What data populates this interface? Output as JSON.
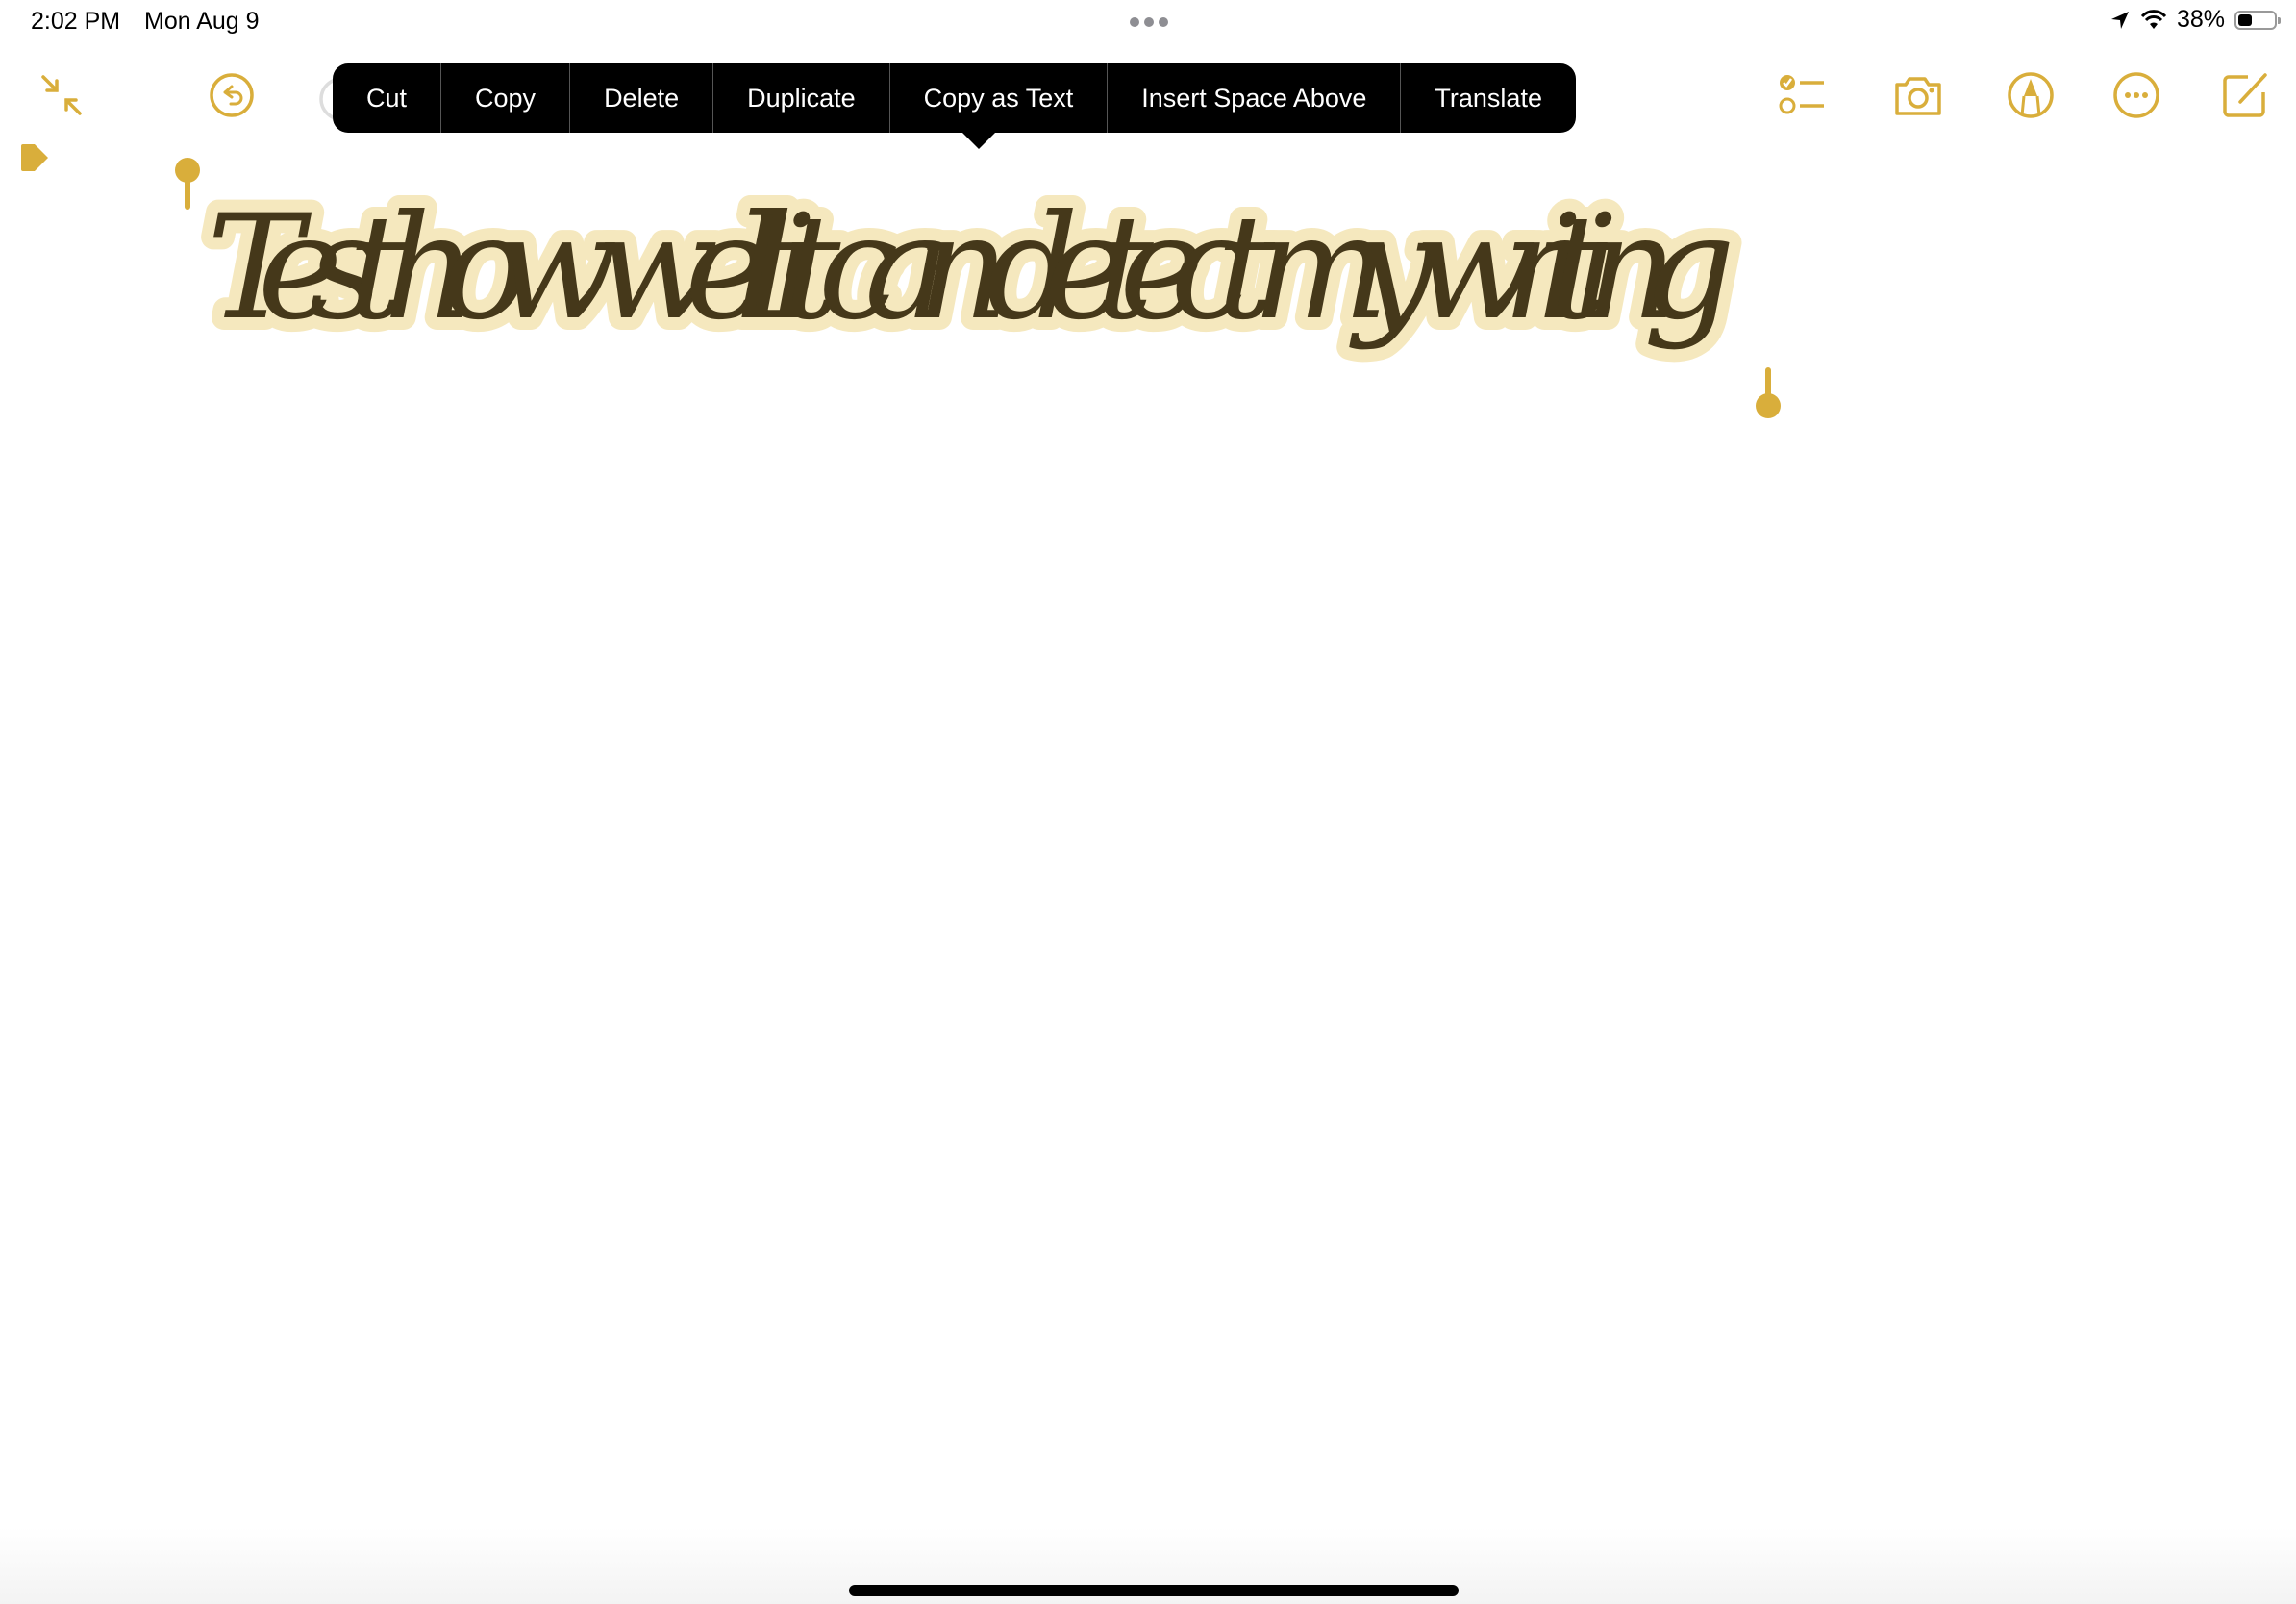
{
  "status_bar": {
    "time": "2:02 PM",
    "date": "Mon Aug 9",
    "battery_percent_label": "38%",
    "battery_level": 0.38,
    "icons": [
      "location-arrow-icon",
      "wifi-icon",
      "battery-icon"
    ]
  },
  "toolbar": {
    "left": [
      {
        "name": "collapse-icon",
        "label": "Collapse"
      },
      {
        "name": "undo-icon",
        "label": "Undo"
      }
    ],
    "right": [
      {
        "name": "checklist-icon",
        "label": "Checklist"
      },
      {
        "name": "camera-icon",
        "label": "Camera"
      },
      {
        "name": "markup-icon",
        "label": "Markup"
      },
      {
        "name": "more-icon",
        "label": "More"
      },
      {
        "name": "compose-icon",
        "label": "New Note"
      }
    ],
    "accent_color": "#D9AE3B"
  },
  "context_menu": {
    "items": [
      {
        "label": "Cut"
      },
      {
        "label": "Copy"
      },
      {
        "label": "Delete"
      },
      {
        "label": "Duplicate"
      },
      {
        "label": "Copy as Text"
      },
      {
        "label": "Insert Space Above"
      },
      {
        "label": "Translate"
      }
    ]
  },
  "note": {
    "handwriting_text": "Test how well it can detect my writing",
    "ink_color": "#45381A",
    "selection_highlight_color": "#F5E8BE"
  }
}
